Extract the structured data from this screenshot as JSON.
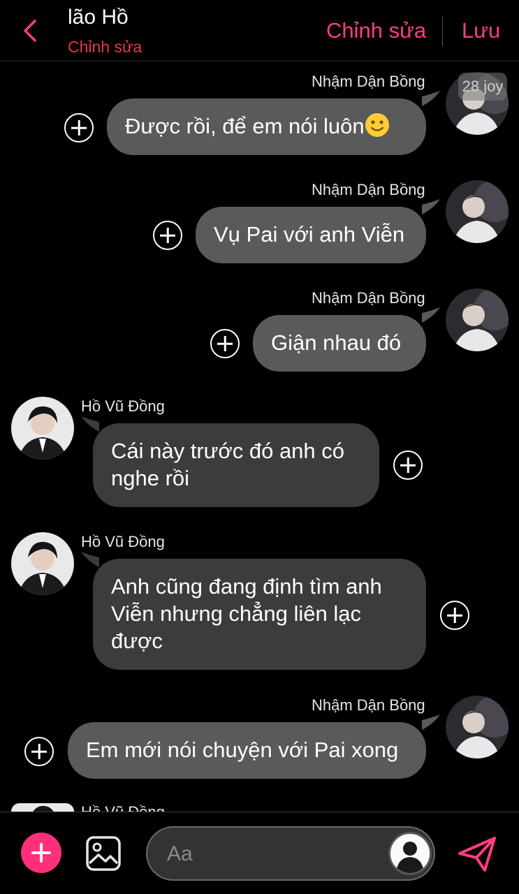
{
  "header": {
    "title": "lão Hồ",
    "subtitle": "Chỉnh sửa",
    "edit_label": "Chỉnh sửa",
    "save_label": "Lưu",
    "accent_color": "#ff3d7f"
  },
  "badge": "28 joy",
  "messages": [
    {
      "sender": "Nhậm Dận Bồng",
      "text": "Được rồi, để em nói luôn",
      "emoji": "slightly-smiling-face",
      "side": "right"
    },
    {
      "sender": "Nhậm Dận Bồng",
      "text": "Vụ Pai với anh Viễn",
      "side": "right"
    },
    {
      "sender": "Nhậm Dận Bồng",
      "text": "Giận nhau đó",
      "side": "right"
    },
    {
      "sender": "Hồ Vũ Đồng",
      "text_lines": [
        "Cái này trước đó anh có",
        "nghe rồi"
      ],
      "side": "left"
    },
    {
      "sender": "Hồ Vũ Đồng",
      "text_lines": [
        "Anh cũng đang định tìm anh",
        "Viễn nhưng chẳng liên lạc",
        "được"
      ],
      "side": "left"
    },
    {
      "sender": "Nhậm Dận Bồng",
      "text": "Em mới nói chuyện với Pai xong",
      "side": "right"
    }
  ],
  "partial_sender": "Hồ Vũ Đồng",
  "composer": {
    "placeholder": "Aa",
    "icons": [
      "add-icon",
      "gallery-icon",
      "user-avatar-icon",
      "send-icon"
    ]
  }
}
